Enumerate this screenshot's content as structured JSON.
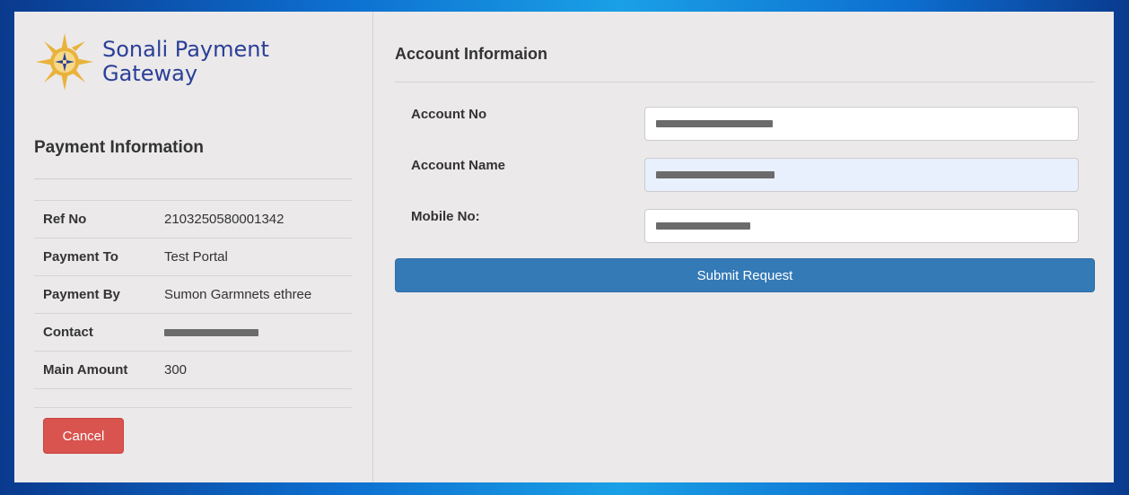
{
  "brand": {
    "logo_icon": "sun-compass-logo",
    "name_line1": "Sonali Payment",
    "name_line2": "Gateway",
    "accent_color": "#2b3f97",
    "logo_color": "#e9b23a"
  },
  "payment_info": {
    "title": "Payment Information",
    "rows": [
      {
        "label": "Ref No",
        "value": "2103250580001342"
      },
      {
        "label": "Payment To",
        "value": "Test Portal"
      },
      {
        "label": "Payment By",
        "value": "Sumon Garmnets ethree"
      },
      {
        "label": "Contact",
        "value": ""
      },
      {
        "label": "Main Amount",
        "value": "300"
      }
    ],
    "cancel_label": "Cancel",
    "cancel_color": "#d9534f"
  },
  "account_info": {
    "title": "Account Informaion",
    "fields": [
      {
        "label": "Account No",
        "value": ""
      },
      {
        "label": "Account Name",
        "value": ""
      },
      {
        "label": "Mobile No:",
        "value": ""
      }
    ],
    "submit_label": "Submit Request",
    "submit_color": "#337ab7"
  }
}
